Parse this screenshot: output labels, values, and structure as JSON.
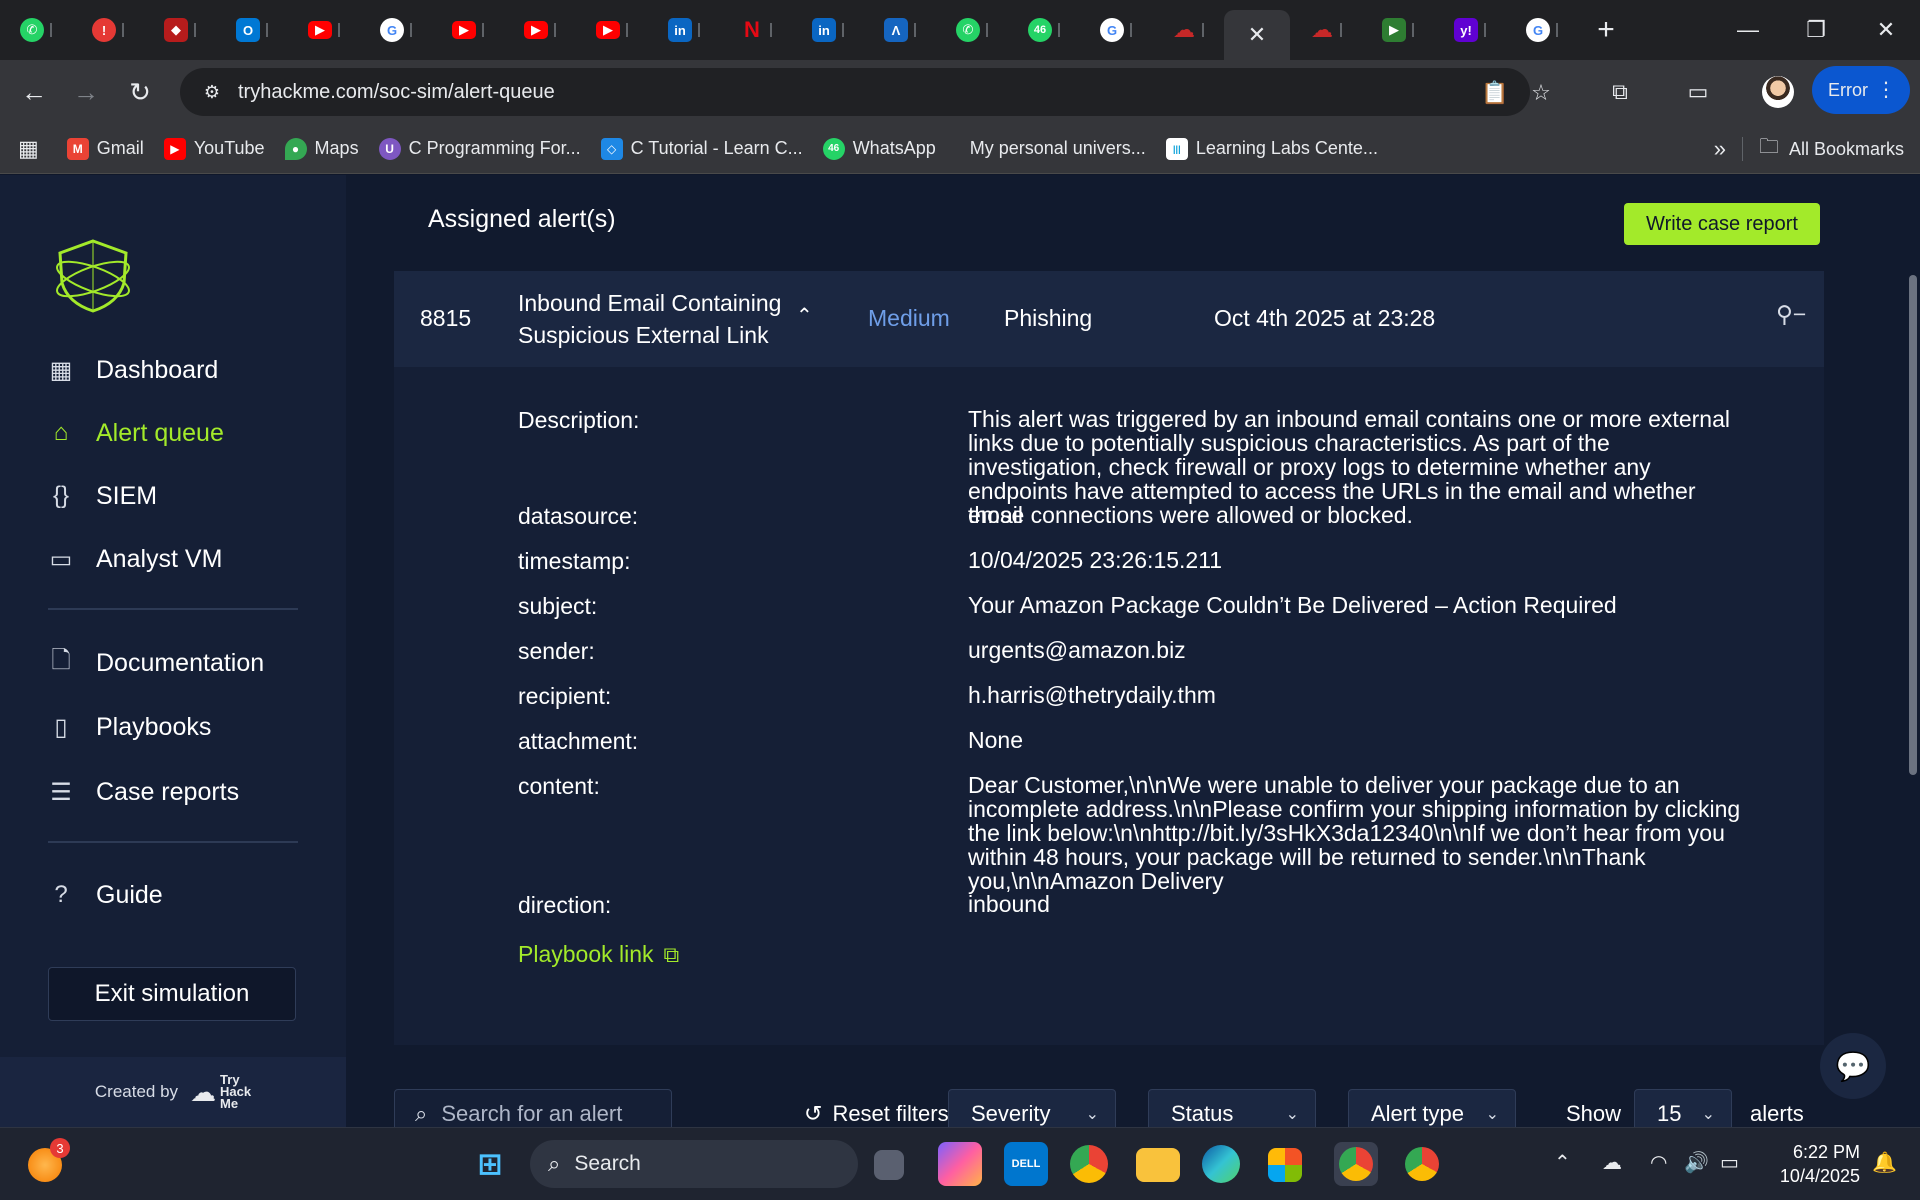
{
  "browser": {
    "address": "tryhackme.com/soc-sim/alert-queue",
    "profile_button": "Error",
    "bookmarks": [
      {
        "label": "Gmail",
        "icon": "gmail-icon",
        "color": "#ea4335"
      },
      {
        "label": "YouTube",
        "icon": "youtube-icon",
        "color": "#ff0000"
      },
      {
        "label": "Maps",
        "icon": "maps-icon",
        "color": "#34a853"
      },
      {
        "label": "C Programming For...",
        "icon": "course-icon",
        "color": "#7e57c2"
      },
      {
        "label": "C Tutorial - Learn C...",
        "icon": "tutorial-icon",
        "color": "#1e88e5"
      },
      {
        "label": "WhatsApp",
        "icon": "whatsapp-icon",
        "color": "#25d366"
      },
      {
        "label": "My personal univers...",
        "icon": "",
        "color": ""
      },
      {
        "label": "Learning Labs Cente...",
        "icon": "cisco-icon",
        "color": "#049fd9"
      }
    ],
    "all_bookmarks": "All Bookmarks"
  },
  "sidebar": {
    "nav": [
      {
        "label": "Dashboard",
        "icon": "dashboard-icon"
      },
      {
        "label": "Alert queue",
        "icon": "alert-queue-icon"
      },
      {
        "label": "SIEM",
        "icon": "braces-icon"
      },
      {
        "label": "Analyst VM",
        "icon": "monitor-icon"
      }
    ],
    "resources": [
      {
        "label": "Documentation",
        "icon": "document-icon"
      },
      {
        "label": "Playbooks",
        "icon": "book-icon"
      },
      {
        "label": "Case reports",
        "icon": "report-icon"
      }
    ],
    "guide": "Guide",
    "exit": "Exit simulation",
    "created_by": "Created by",
    "brand_mark": [
      "Try",
      "Hack",
      "Me"
    ]
  },
  "main": {
    "heading": "Assigned alert(s)",
    "case_report_button": "Write case report",
    "alert": {
      "id": "8815",
      "title_line1": "Inbound Email Containing",
      "title_line2": "Suspicious External Link",
      "severity": "Medium",
      "type": "Phishing",
      "time": "Oct 4th 2025 at 23:28"
    },
    "details": [
      {
        "key": "Description:",
        "value": "This alert was triggered by an inbound email contains one or more external links due to potentially suspicious characteristics. As part of the investigation, check firewall or proxy logs to determine whether any endpoints have attempted to access the URLs in the email and whether those connections were allowed or blocked."
      },
      {
        "key": "datasource:",
        "value": "email"
      },
      {
        "key": "timestamp:",
        "value": "10/04/2025 23:26:15.211"
      },
      {
        "key": "subject:",
        "value": "Your Amazon Package Couldn’t Be Delivered – Action Required"
      },
      {
        "key": "sender:",
        "value": "urgents@amazon.biz"
      },
      {
        "key": "recipient:",
        "value": "h.harris@thetrydaily.thm"
      },
      {
        "key": "attachment:",
        "value": "None"
      },
      {
        "key": "content:",
        "value": "Dear Customer,\\n\\nWe were unable to deliver your package due to an incomplete address.\\n\\nPlease confirm your shipping information by clicking the link below:\\n\\nhttp://bit.ly/3sHkX3da12340\\n\\nIf we don’t hear from you within 48 hours, your package will be returned to sender.\\n\\nThank you,\\n\\nAmazon Delivery"
      },
      {
        "key": "direction:",
        "value": "inbound"
      }
    ],
    "playbook_link": "Playbook link",
    "filters": {
      "search_placeholder": "Search for an alert",
      "reset": "Reset filters",
      "severity": "Severity",
      "status": "Status",
      "alert_type": "Alert type",
      "show_label": "Show",
      "show_value": "15",
      "alerts_label": "alerts"
    }
  },
  "taskbar": {
    "search": "Search",
    "time": "6:22 PM",
    "date": "10/4/2025",
    "notification_badge": "3"
  },
  "colors": {
    "accent": "#a3ea2a",
    "severity_medium": "#6f9ee8",
    "page_bg": "#111a2e"
  }
}
